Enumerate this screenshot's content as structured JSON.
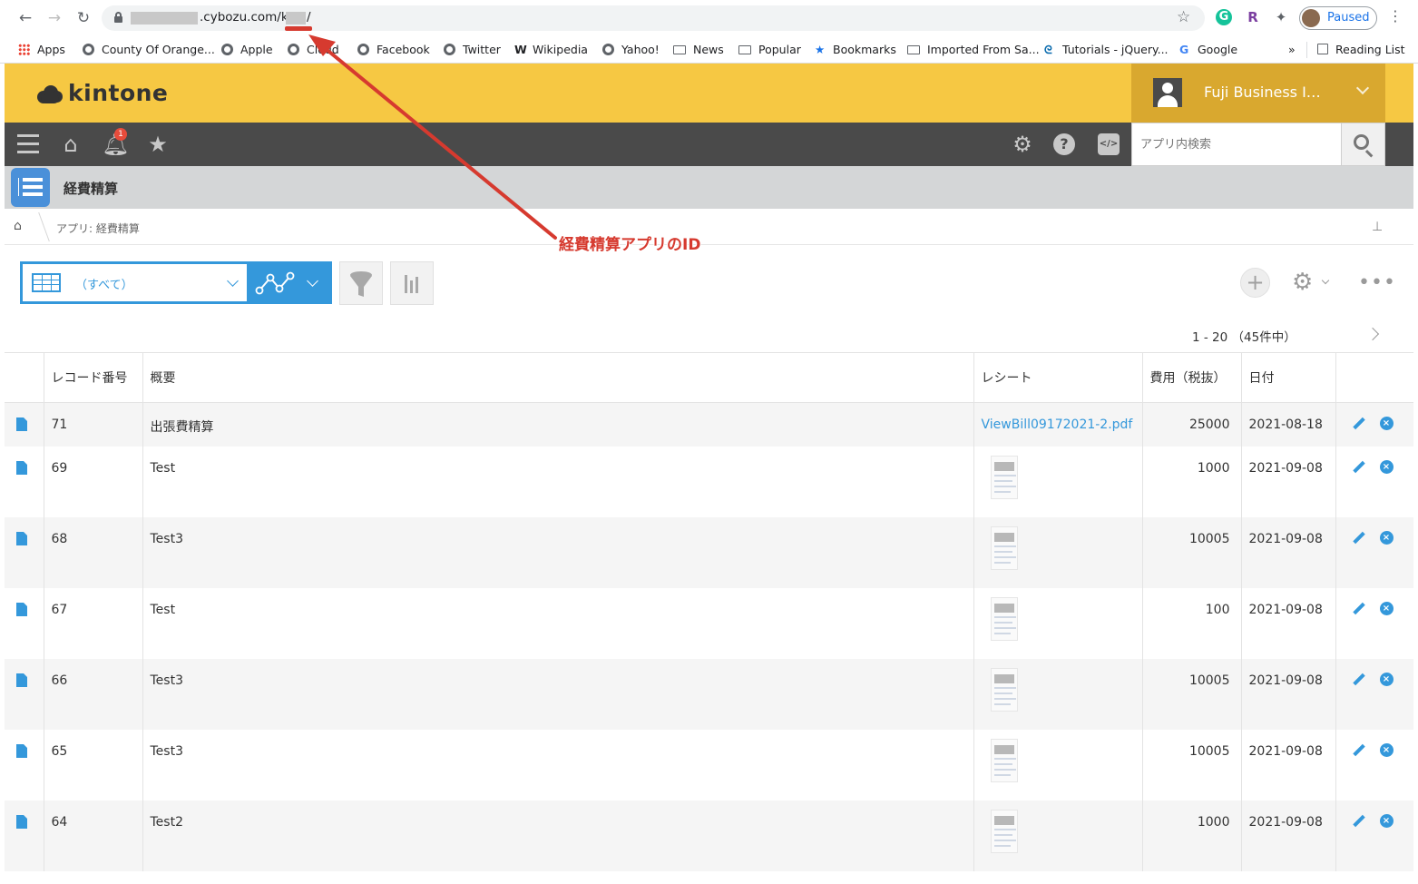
{
  "browser": {
    "url_domain": ".cybozu.com/k/",
    "url_tail": "/",
    "profile_label": "Paused",
    "ext_g": "G",
    "ext_r": "R",
    "bookmarks": [
      {
        "label": "Apps",
        "icon": "apps-grid-icon"
      },
      {
        "label": "County Of Orange...",
        "icon": "globe-icon"
      },
      {
        "label": "Apple",
        "icon": "globe-icon"
      },
      {
        "label": "Cloud",
        "icon": "globe-icon"
      },
      {
        "label": "Facebook",
        "icon": "globe-icon"
      },
      {
        "label": "Twitter",
        "icon": "globe-icon"
      },
      {
        "label": "Wikipedia",
        "icon": "wikipedia-icon"
      },
      {
        "label": "Yahoo!",
        "icon": "globe-icon"
      },
      {
        "label": "News",
        "icon": "folder-icon"
      },
      {
        "label": "Popular",
        "icon": "folder-icon"
      },
      {
        "label": "Bookmarks",
        "icon": "star-icon"
      },
      {
        "label": "Imported From Sa...",
        "icon": "folder-icon"
      },
      {
        "label": "Tutorials - jQuery...",
        "icon": "jquery-icon"
      },
      {
        "label": "Google",
        "icon": "google-icon"
      }
    ],
    "overflow": "»",
    "reading_list": "Reading List"
  },
  "header": {
    "logo_text": "kintone",
    "user_name": "Fuji Business I…",
    "notification_count": "1",
    "search_placeholder": "アプリ内検索"
  },
  "app": {
    "title": "経費精算",
    "breadcrumb": "アプリ: 経費精算"
  },
  "view": {
    "name": "（すべて）",
    "pager": "1 - 20 （45件中）"
  },
  "table": {
    "columns": [
      "レコード番号",
      "概要",
      "レシート",
      "費用（税抜）",
      "日付"
    ],
    "rows": [
      {
        "id": "71",
        "summary": "出張費精算",
        "receipt": "ViewBill09172021-2.pdf",
        "cost": "25000",
        "date": "2021-08-18"
      },
      {
        "id": "69",
        "summary": "Test",
        "receipt": "",
        "cost": "1000",
        "date": "2021-09-08"
      },
      {
        "id": "68",
        "summary": "Test3",
        "receipt": "",
        "cost": "10005",
        "date": "2021-09-08"
      },
      {
        "id": "67",
        "summary": "Test",
        "receipt": "",
        "cost": "100",
        "date": "2021-09-08"
      },
      {
        "id": "66",
        "summary": "Test3",
        "receipt": "",
        "cost": "10005",
        "date": "2021-09-08"
      },
      {
        "id": "65",
        "summary": "Test3",
        "receipt": "",
        "cost": "10005",
        "date": "2021-09-08"
      },
      {
        "id": "64",
        "summary": "Test2",
        "receipt": "",
        "cost": "1000",
        "date": "2021-09-08"
      }
    ]
  },
  "annotation": {
    "label": "経費精算アプリのID",
    "color": "#d63a2f"
  },
  "colors": {
    "header_yellow": "#f6c843",
    "toolbar_dark": "#4a4a4a",
    "accent_blue": "#3498db"
  }
}
